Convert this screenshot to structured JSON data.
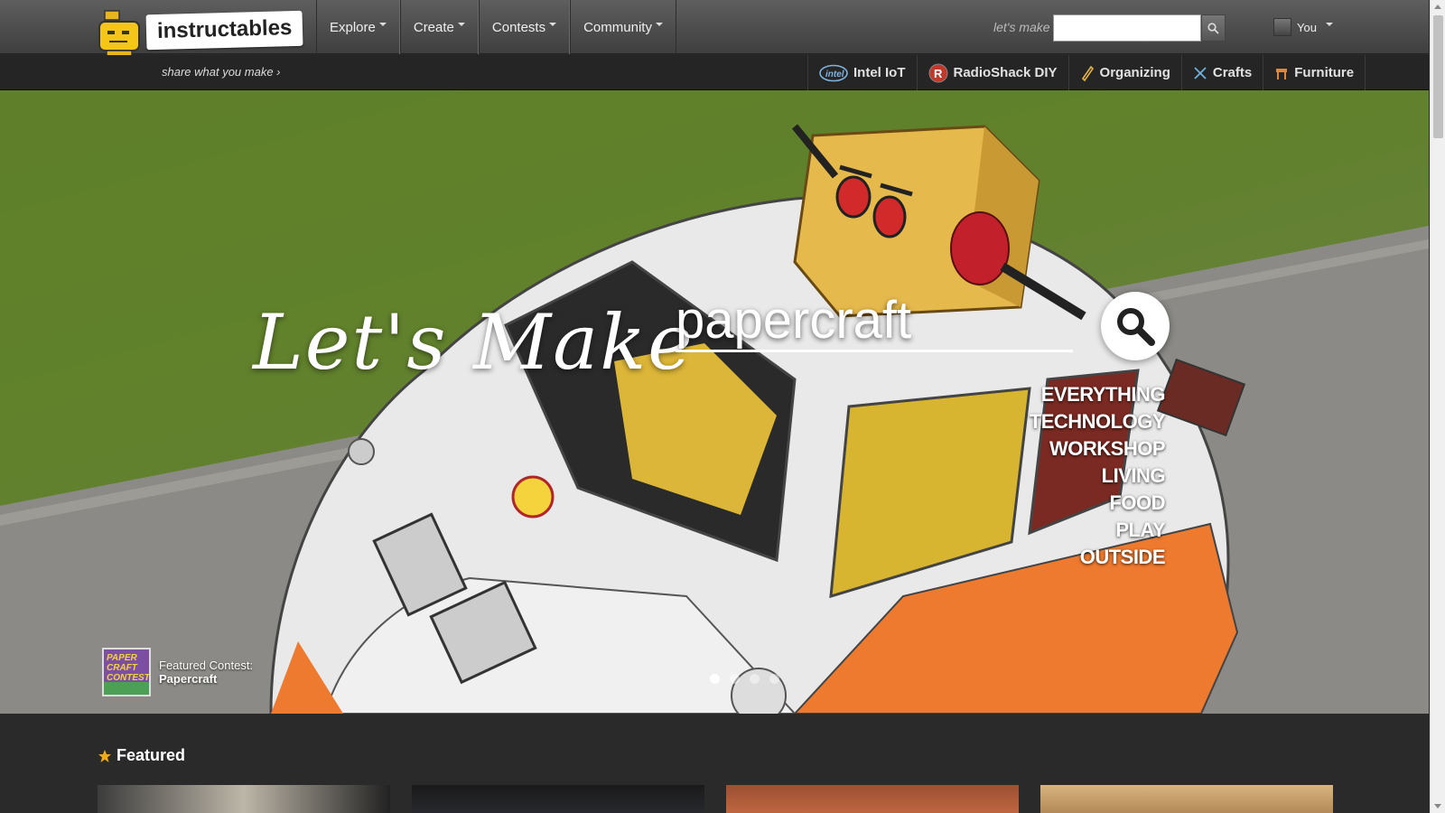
{
  "brand": {
    "name": "instructables",
    "tagline": "share what you make ›"
  },
  "nav": [
    {
      "label": "Explore"
    },
    {
      "label": "Create"
    },
    {
      "label": "Contests"
    },
    {
      "label": "Community"
    }
  ],
  "header_search": {
    "label": "let's make",
    "placeholder": ""
  },
  "user": {
    "label": "You"
  },
  "channels": [
    {
      "label": "Intel IoT",
      "icon": "intel-icon"
    },
    {
      "label": "RadioShack DIY",
      "icon": "radioshack-icon"
    },
    {
      "label": "Organizing",
      "icon": "pencil-icon"
    },
    {
      "label": "Crafts",
      "icon": "scissors-icon"
    },
    {
      "label": "Furniture",
      "icon": "chair-icon"
    }
  ],
  "hero": {
    "headline": "Let's Make",
    "search_value": "papercraft",
    "categories": [
      "EVERYTHING",
      "TECHNOLOGY",
      "WORKSHOP",
      "LIVING",
      "FOOD",
      "PLAY",
      "OUTSIDE"
    ],
    "contest": {
      "caption": "Featured Contest:",
      "name": "Papercraft",
      "thumb_text": "PAPER CRAFT CONTEST"
    },
    "slide_count": 4,
    "active_slide": 1
  },
  "featured": {
    "title": "Featured"
  }
}
